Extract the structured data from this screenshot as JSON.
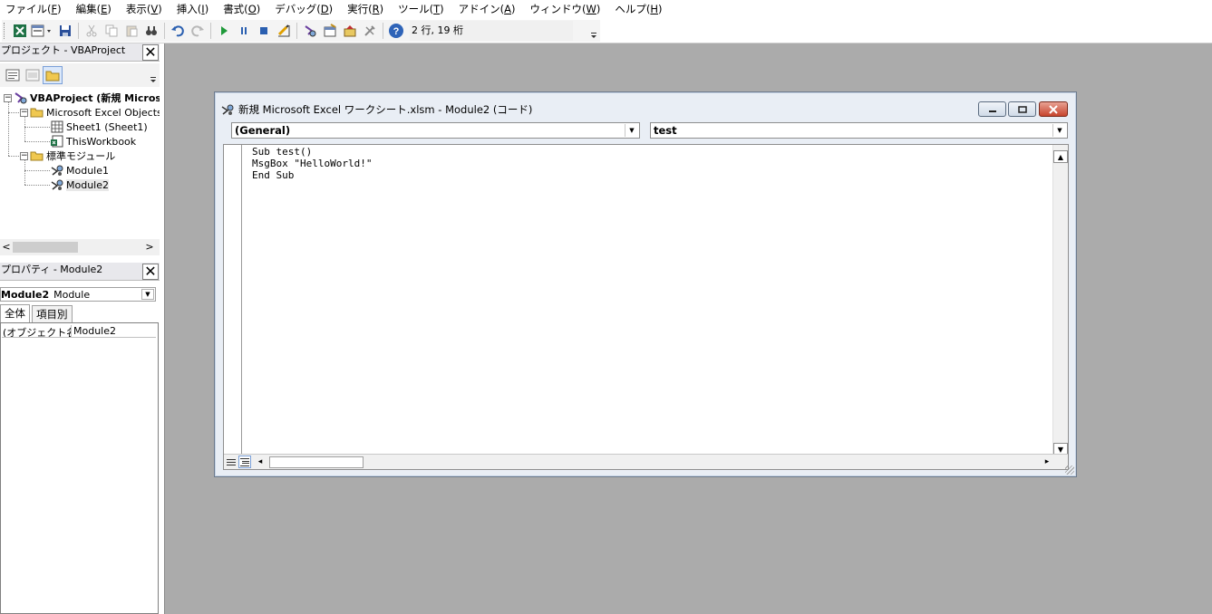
{
  "menu": [
    {
      "label": "ファイル(",
      "key": "F",
      "end": ")"
    },
    {
      "label": "編集(",
      "key": "E",
      "end": ")"
    },
    {
      "label": "表示(",
      "key": "V",
      "end": ")"
    },
    {
      "label": "挿入(",
      "key": "I",
      "end": ")"
    },
    {
      "label": "書式(",
      "key": "O",
      "end": ")"
    },
    {
      "label": "デバッグ(",
      "key": "D",
      "end": ")"
    },
    {
      "label": "実行(",
      "key": "R",
      "end": ")"
    },
    {
      "label": "ツール(",
      "key": "T",
      "end": ")"
    },
    {
      "label": "アドイン(",
      "key": "A",
      "end": ")"
    },
    {
      "label": "ウィンドウ(",
      "key": "W",
      "end": ")"
    },
    {
      "label": "ヘルプ(",
      "key": "H",
      "end": ")"
    }
  ],
  "toolbar": {
    "cursor_position": "2 行, 19 桁"
  },
  "project_pane": {
    "title": "プロジェクト - VBAProject",
    "close_glyph": "✕",
    "tree": {
      "root": "VBAProject (新規 Microsoft Excel ワークシート.xlsm)",
      "folder_objects": "Microsoft Excel Objects",
      "sheet1": "Sheet1 (Sheet1)",
      "thisworkbook": "ThisWorkbook",
      "folder_modules": "標準モジュール",
      "module1": "Module1",
      "module2": "Module2"
    },
    "scroll_left": "<",
    "scroll_right": ">"
  },
  "properties_pane": {
    "title": "プロパティ - Module2",
    "close_glyph": "✕",
    "object_name": "Module2",
    "object_type": "Module",
    "tabs": [
      "全体",
      "項目別"
    ],
    "rows": [
      {
        "name": "(オブジェクト名)",
        "value": "Module2"
      }
    ]
  },
  "code_window": {
    "title": "新規 Microsoft Excel ワークシート.xlsm - Module2 (コード)",
    "object_combo": "(General)",
    "procedure_combo": "test",
    "code_lines": [
      "Sub test()",
      "MsgBox \"HelloWorld!\"",
      "End Sub"
    ]
  },
  "colors": {
    "mdi_background": "#ababab",
    "close_button": "#c7442d"
  }
}
